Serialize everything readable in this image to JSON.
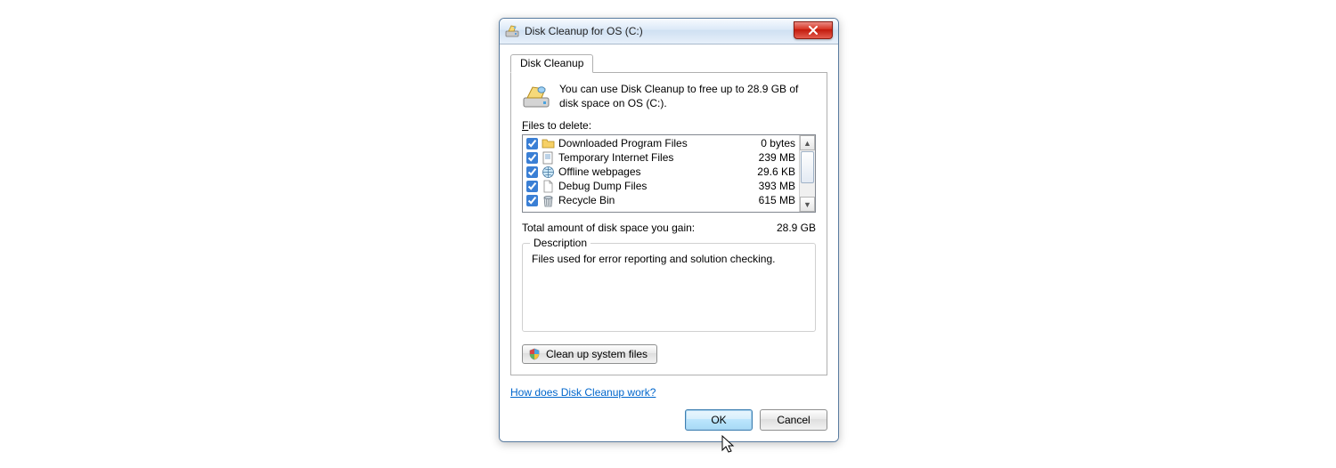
{
  "window": {
    "title": "Disk Cleanup for OS (C:)"
  },
  "tab": {
    "label": "Disk Cleanup"
  },
  "intro": "You can use Disk Cleanup to free up to 28.9 GB of disk space on OS (C:).",
  "files_label_pre": "F",
  "files_label_post": "iles to delete:",
  "files": [
    {
      "name": "Downloaded Program Files",
      "size": "0 bytes",
      "checked": true,
      "icon": "folder"
    },
    {
      "name": "Temporary Internet Files",
      "size": "239 MB",
      "checked": true,
      "icon": "doc"
    },
    {
      "name": "Offline webpages",
      "size": "29.6 KB",
      "checked": true,
      "icon": "globe"
    },
    {
      "name": "Debug Dump Files",
      "size": "393 MB",
      "checked": true,
      "icon": "file"
    },
    {
      "name": "Recycle Bin",
      "size": "615 MB",
      "checked": true,
      "icon": "bin"
    }
  ],
  "total_label": "Total amount of disk space you gain:",
  "total_value": "28.9 GB",
  "description": {
    "legend": "Description",
    "text": "Files used for error reporting and solution checking."
  },
  "cleanup_sys": "Clean up system files",
  "help_link": "How does Disk Cleanup work?",
  "buttons": {
    "ok": "OK",
    "cancel": "Cancel"
  }
}
